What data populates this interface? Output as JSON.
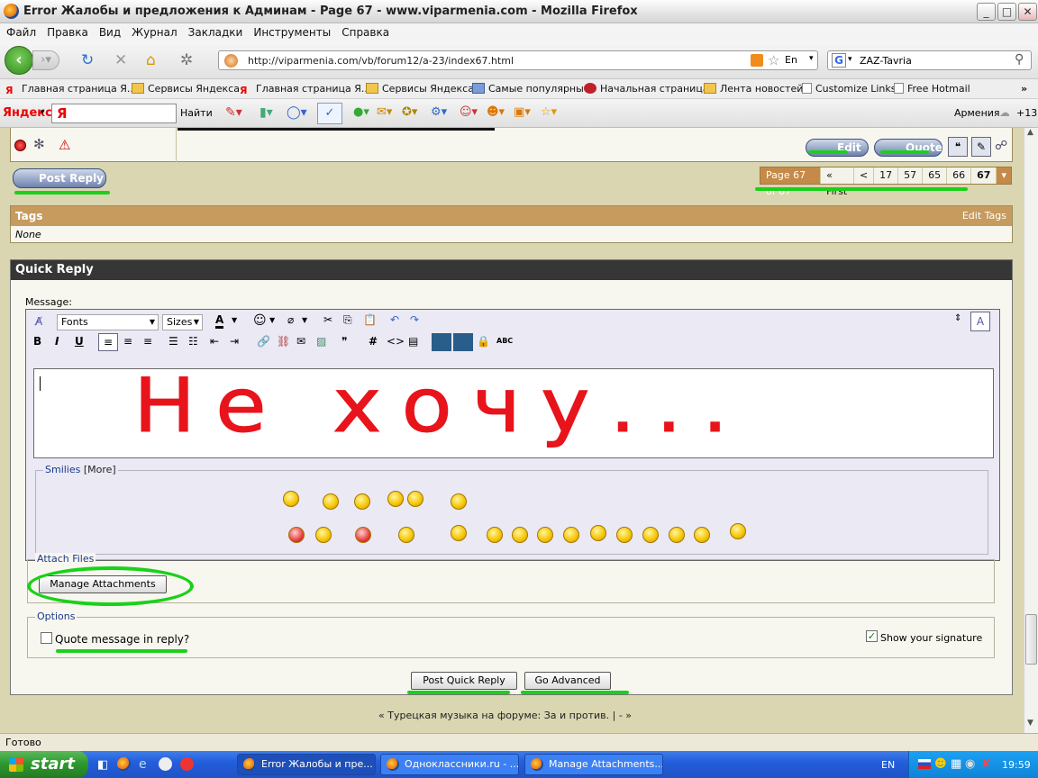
{
  "window": {
    "title": "Error Жалобы и предложения к Админам - Page 67 - www.viparmenia.com - Mozilla Firefox",
    "controls": {
      "minimize": "_",
      "maximize": "□",
      "close": "✕"
    }
  },
  "menu": [
    "Файл",
    "Правка",
    "Вид",
    "Журнал",
    "Закладки",
    "Инструменты",
    "Справка"
  ],
  "nav": {
    "url": "http://viparmenia.com/vb/forum12/a-23/index67.html",
    "search_value": "ZAZ-Tavria",
    "lang_indicator": "En"
  },
  "bookmarks": [
    {
      "label": "Главная страница Я...",
      "icon": "yandex-icon"
    },
    {
      "label": "Сервисы Яндекса",
      "icon": "folder-icon"
    },
    {
      "label": "Главная страница Я...",
      "icon": "yandex-icon"
    },
    {
      "label": "Сервисы Яндекса",
      "icon": "folder-icon"
    },
    {
      "label": "Самые популярные",
      "icon": "popular-icon"
    },
    {
      "label": "Начальная страница",
      "icon": "home-page-icon"
    },
    {
      "label": "Лента новостей",
      "icon": "rss-icon"
    },
    {
      "label": "Customize Links",
      "icon": "page-icon"
    },
    {
      "label": "Free Hotmail",
      "icon": "page-icon"
    }
  ],
  "yandex": {
    "brand": "Яндекс",
    "find": "Найти",
    "region": "Армения",
    "temperature": "+13"
  },
  "post": {
    "edit_label": "Edit",
    "quote_label": "Quote",
    "post_reply_label": "Post Reply"
  },
  "pagenav": {
    "current": "Page 67 of 67",
    "first": "« First",
    "prev": "<",
    "pages": [
      "17",
      "57",
      "65",
      "66",
      "67"
    ]
  },
  "tags": {
    "title": "Tags",
    "edit": "Edit Tags",
    "value": "None"
  },
  "quick_reply": {
    "title": "Quick Reply",
    "message_label": "Message:",
    "fonts": "Fonts",
    "sizes": "Sizes",
    "handwriting": "Не хочу...",
    "smilies_label": "Smilies",
    "smilies_more": "[More]",
    "attach_label": "Attach Files",
    "manage_attachments": "Manage Attachments",
    "options_label": "Options",
    "quote_in_reply": "Quote message in reply?",
    "quote_checked": false,
    "show_signature": "Show your signature",
    "signature_checked": true,
    "post_quick_reply": "Post Quick Reply",
    "go_advanced": "Go Advanced"
  },
  "footer_link": "« Турецкая музыка на форуме: За и против. | - »",
  "status": "Готово",
  "taskbar": {
    "start": "start",
    "tasks": [
      "Error Жалобы и пре...",
      "Одноклассники.ru - ...",
      "Manage Attachments..."
    ],
    "lang": "EN",
    "clock": "19:59"
  },
  "colors": {
    "highlight_green": "#19d119",
    "handwriting_red": "#e8141c",
    "tags_header": "#c79a5d",
    "quick_reply_header": "#363636",
    "page_bg": "#d9d6b1"
  }
}
